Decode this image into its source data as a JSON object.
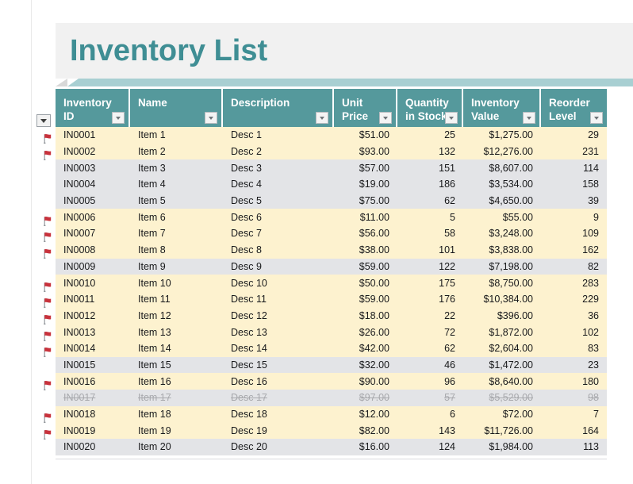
{
  "page": {
    "title": "Inventory List",
    "accent_color": "#55999c",
    "title_color": "#3f8e94",
    "flag_color": "#c8323c",
    "row_flagged_bg": "#fdf2cf",
    "row_plain_bg": "#e3e4e7"
  },
  "filter_button": {
    "name": "flag-column-filter",
    "icon": "chevron-down-icon"
  },
  "table": {
    "columns": [
      {
        "label": "Inventory ID",
        "align": "left",
        "filter_icon": "chevron-down-icon"
      },
      {
        "label": "Name",
        "align": "left",
        "filter_icon": "chevron-down-icon"
      },
      {
        "label": "Description",
        "align": "left",
        "filter_icon": "chevron-down-icon"
      },
      {
        "label": "Unit Price",
        "align": "right",
        "filter_icon": "chevron-down-icon"
      },
      {
        "label": "Quantity in Stock",
        "align": "right",
        "filter_icon": "chevron-down-icon"
      },
      {
        "label": "Inventory Value",
        "align": "right",
        "filter_icon": "chevron-down-icon"
      },
      {
        "label": "Reorder Level",
        "align": "right",
        "filter_icon": "chevron-down-icon"
      }
    ],
    "rows": [
      {
        "flag": true,
        "strike": false,
        "id": "IN0001",
        "name": "Item 1",
        "desc": "Desc 1",
        "unit_price": "$51.00",
        "qty": "25",
        "value": "$1,275.00",
        "reorder": "29"
      },
      {
        "flag": true,
        "strike": false,
        "id": "IN0002",
        "name": "Item 2",
        "desc": "Desc 2",
        "unit_price": "$93.00",
        "qty": "132",
        "value": "$12,276.00",
        "reorder": "231"
      },
      {
        "flag": false,
        "strike": false,
        "id": "IN0003",
        "name": "Item 3",
        "desc": "Desc 3",
        "unit_price": "$57.00",
        "qty": "151",
        "value": "$8,607.00",
        "reorder": "114"
      },
      {
        "flag": false,
        "strike": false,
        "id": "IN0004",
        "name": "Item 4",
        "desc": "Desc 4",
        "unit_price": "$19.00",
        "qty": "186",
        "value": "$3,534.00",
        "reorder": "158"
      },
      {
        "flag": false,
        "strike": false,
        "id": "IN0005",
        "name": "Item 5",
        "desc": "Desc 5",
        "unit_price": "$75.00",
        "qty": "62",
        "value": "$4,650.00",
        "reorder": "39"
      },
      {
        "flag": true,
        "strike": false,
        "id": "IN0006",
        "name": "Item 6",
        "desc": "Desc 6",
        "unit_price": "$11.00",
        "qty": "5",
        "value": "$55.00",
        "reorder": "9"
      },
      {
        "flag": true,
        "strike": false,
        "id": "IN0007",
        "name": "Item 7",
        "desc": "Desc 7",
        "unit_price": "$56.00",
        "qty": "58",
        "value": "$3,248.00",
        "reorder": "109"
      },
      {
        "flag": true,
        "strike": false,
        "id": "IN0008",
        "name": "Item 8",
        "desc": "Desc 8",
        "unit_price": "$38.00",
        "qty": "101",
        "value": "$3,838.00",
        "reorder": "162"
      },
      {
        "flag": false,
        "strike": false,
        "id": "IN0009",
        "name": "Item 9",
        "desc": "Desc 9",
        "unit_price": "$59.00",
        "qty": "122",
        "value": "$7,198.00",
        "reorder": "82"
      },
      {
        "flag": true,
        "strike": false,
        "id": "IN0010",
        "name": "Item 10",
        "desc": "Desc 10",
        "unit_price": "$50.00",
        "qty": "175",
        "value": "$8,750.00",
        "reorder": "283"
      },
      {
        "flag": true,
        "strike": false,
        "id": "IN0011",
        "name": "Item 11",
        "desc": "Desc 11",
        "unit_price": "$59.00",
        "qty": "176",
        "value": "$10,384.00",
        "reorder": "229"
      },
      {
        "flag": true,
        "strike": false,
        "id": "IN0012",
        "name": "Item 12",
        "desc": "Desc 12",
        "unit_price": "$18.00",
        "qty": "22",
        "value": "$396.00",
        "reorder": "36"
      },
      {
        "flag": true,
        "strike": false,
        "id": "IN0013",
        "name": "Item 13",
        "desc": "Desc 13",
        "unit_price": "$26.00",
        "qty": "72",
        "value": "$1,872.00",
        "reorder": "102"
      },
      {
        "flag": true,
        "strike": false,
        "id": "IN0014",
        "name": "Item 14",
        "desc": "Desc 14",
        "unit_price": "$42.00",
        "qty": "62",
        "value": "$2,604.00",
        "reorder": "83"
      },
      {
        "flag": false,
        "strike": false,
        "id": "IN0015",
        "name": "Item 15",
        "desc": "Desc 15",
        "unit_price": "$32.00",
        "qty": "46",
        "value": "$1,472.00",
        "reorder": "23"
      },
      {
        "flag": true,
        "strike": false,
        "id": "IN0016",
        "name": "Item 16",
        "desc": "Desc 16",
        "unit_price": "$90.00",
        "qty": "96",
        "value": "$8,640.00",
        "reorder": "180"
      },
      {
        "flag": false,
        "strike": true,
        "id": "IN0017",
        "name": "Item 17",
        "desc": "Desc 17",
        "unit_price": "$97.00",
        "qty": "57",
        "value": "$5,529.00",
        "reorder": "98"
      },
      {
        "flag": true,
        "strike": false,
        "id": "IN0018",
        "name": "Item 18",
        "desc": "Desc 18",
        "unit_price": "$12.00",
        "qty": "6",
        "value": "$72.00",
        "reorder": "7"
      },
      {
        "flag": true,
        "strike": false,
        "id": "IN0019",
        "name": "Item 19",
        "desc": "Desc 19",
        "unit_price": "$82.00",
        "qty": "143",
        "value": "$11,726.00",
        "reorder": "164"
      },
      {
        "flag": false,
        "strike": false,
        "id": "IN0020",
        "name": "Item 20",
        "desc": "Desc 20",
        "unit_price": "$16.00",
        "qty": "124",
        "value": "$1,984.00",
        "reorder": "113"
      }
    ]
  }
}
